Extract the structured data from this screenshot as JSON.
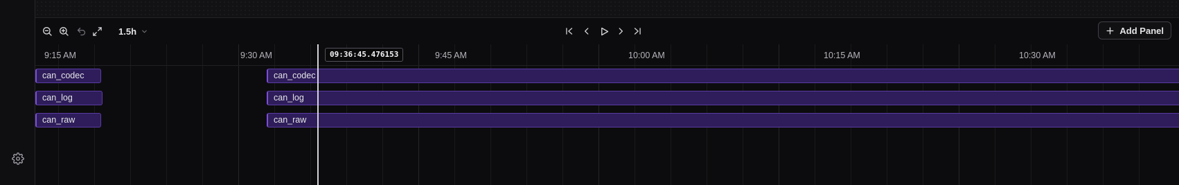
{
  "toolbar": {
    "zoom_out_icon": "zoom-out-icon",
    "zoom_in_icon": "zoom-in-icon",
    "undo_icon": "undo-icon",
    "fit_icon": "expand-icon",
    "range_label": "1.5h",
    "add_panel_label": "Add Panel"
  },
  "timeline": {
    "tick_labels": [
      "9:15 AM",
      "9:30 AM",
      "9:45 AM",
      "10:00 AM",
      "10:15 AM",
      "10:30 AM"
    ],
    "cursor_time": "09:36:45.476153",
    "tracks": [
      {
        "label_left": "can_codec",
        "label_right": "can_codec"
      },
      {
        "label_left": "can_log",
        "label_right": "can_log"
      },
      {
        "label_left": "can_raw",
        "label_right": "can_raw"
      }
    ]
  },
  "colors": {
    "track_fill": "#2e1d5a",
    "track_border": "#5b3aa3",
    "background": "#0c0c0e"
  }
}
